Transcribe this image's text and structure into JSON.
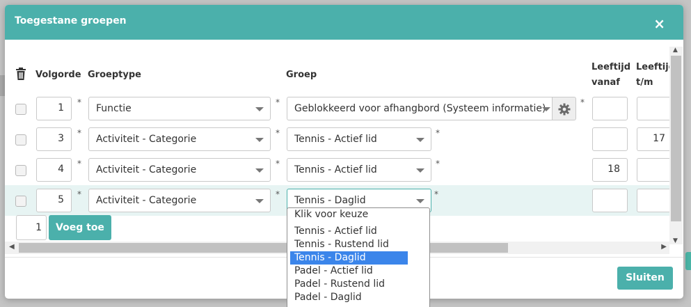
{
  "modal": {
    "title": "Toegestane groepen",
    "close_icon": "×"
  },
  "table": {
    "headers": {
      "volgorde": "Volgorde",
      "groeptype": "Groeptype",
      "groep": "Groep",
      "leeftijd_vanaf_1": "Leeftijd",
      "leeftijd_vanaf_2": "vanaf",
      "leeftijd_tm_1": "Leeftijd",
      "leeftijd_tm_2": "t/m"
    },
    "required_mark": "*",
    "rows": [
      {
        "volgorde": "1",
        "groeptype": "Functie",
        "groep": "Geblokkeerd voor afhangbord (Systeem informatie)",
        "vanaf": "",
        "tm": ""
      },
      {
        "volgorde": "3",
        "groeptype": "Activiteit - Categorie",
        "groep": "Tennis - Actief lid",
        "vanaf": "",
        "tm": "17"
      },
      {
        "volgorde": "4",
        "groeptype": "Activiteit - Categorie",
        "groep": "Tennis - Actief lid",
        "vanaf": "18",
        "tm": ""
      },
      {
        "volgorde": "5",
        "groeptype": "Activiteit - Categorie",
        "groep": "Tennis - Daglid",
        "vanaf": "",
        "tm": ""
      }
    ]
  },
  "add": {
    "quantity": "1",
    "button_label": "Voeg toe"
  },
  "footer": {
    "close_label": "Sluiten"
  },
  "dropdown": {
    "options": [
      "Klik voor keuze",
      "Tennis - Actief lid",
      "Tennis - Rustend lid",
      "Tennis - Daglid",
      "Padel - Actief lid",
      "Padel - Rustend lid",
      "Padel - Daglid"
    ],
    "selected": "Tennis - Daglid"
  },
  "colors": {
    "accent": "#4bb0ab",
    "selected_option": "#3b85ea"
  }
}
